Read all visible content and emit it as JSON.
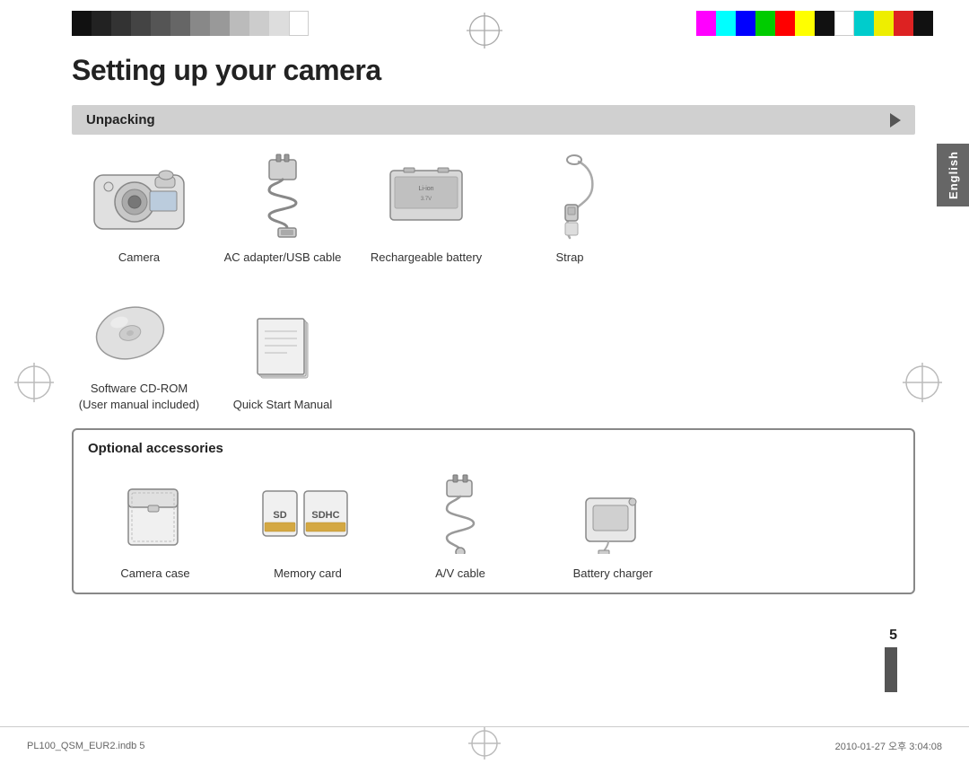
{
  "page": {
    "title": "Setting up your camera",
    "number": "5",
    "file_info": "PL100_QSM_EUR2.indb   5",
    "date_info": "2010-01-27   오후 3:04:08"
  },
  "language_tab": {
    "label": "English"
  },
  "unpacking": {
    "header": "Unpacking",
    "items": [
      {
        "label": "Camera"
      },
      {
        "label": "AC adapter/USB cable"
      },
      {
        "label": "Rechargeable battery"
      },
      {
        "label": "Strap"
      }
    ],
    "items_row2": [
      {
        "label": "Software CD-ROM\n(User manual included)"
      },
      {
        "label": "Quick Start Manual"
      }
    ]
  },
  "optional": {
    "header": "Optional accessories",
    "items": [
      {
        "label": "Camera case"
      },
      {
        "label": "Memory card"
      },
      {
        "label": "A/V cable"
      },
      {
        "label": "Battery charger"
      }
    ]
  },
  "colors_left": [
    "#111",
    "#222",
    "#333",
    "#444",
    "#555",
    "#666",
    "#888",
    "#aaa",
    "#ccc",
    "#ddd",
    "#eee",
    "#fff"
  ],
  "colors_right": [
    "#ff00ff",
    "#00ffff",
    "#0000ff",
    "#00cc00",
    "#ff0000",
    "#ffff00",
    "#111",
    "#fff",
    "#00ffff",
    "#ffff00",
    "#ff0000",
    "#111"
  ]
}
